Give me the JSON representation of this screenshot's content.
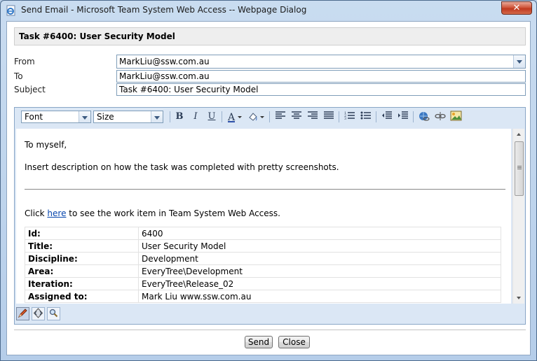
{
  "window": {
    "title": "Send Email - Microsoft Team System Web Access -- Webpage Dialog",
    "close_glyph": "✕"
  },
  "task": {
    "header": "Task #6400: User Security Model"
  },
  "form": {
    "from_label": "From",
    "from_value": "MarkLiu@ssw.com.au",
    "to_label": "To",
    "to_value": "MarkLiu@ssw.com.au",
    "subject_label": "Subject",
    "subject_value": "Task #6400: User Security Model"
  },
  "toolbar": {
    "font_select": "Font",
    "size_select": "Size",
    "icons": [
      "bold-icon",
      "italic-icon",
      "underline-icon",
      "font-color-icon",
      "highlight-color-icon",
      "align-left-icon",
      "align-center-icon",
      "align-right-icon",
      "justify-icon",
      "numbered-list-icon",
      "bullet-list-icon",
      "outdent-icon",
      "indent-icon",
      "insert-link-icon",
      "remove-link-icon",
      "insert-image-icon"
    ]
  },
  "body": {
    "greeting": "To myself,",
    "instruction": "Insert description on how the task was completed with pretty screenshots.",
    "click_prefix": "Click ",
    "link_text": "here",
    "click_suffix": " to see the work item in Team System Web Access.",
    "rows": [
      {
        "key": "Id:",
        "value": "6400"
      },
      {
        "key": "Title:",
        "value": "User Security Model"
      },
      {
        "key": "Discipline:",
        "value": "Development"
      },
      {
        "key": "Area:",
        "value": "EveryTree\\Development"
      },
      {
        "key": "Iteration:",
        "value": "EveryTree\\Release_02"
      },
      {
        "key": "Assigned to:",
        "value": "Mark Liu www.ssw.com.au"
      }
    ]
  },
  "modes": [
    "design-mode-icon",
    "html-mode-icon",
    "preview-mode-icon"
  ],
  "buttons": {
    "send": "Send",
    "close": "Close"
  }
}
